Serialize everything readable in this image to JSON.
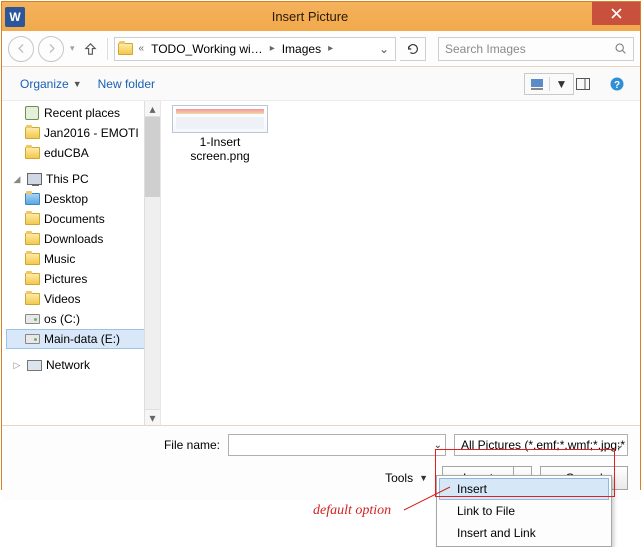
{
  "title": "Insert Picture",
  "breadcrumb": {
    "prefix": "«",
    "seg1": "TODO_Working wi…",
    "seg2": "Images"
  },
  "search": {
    "placeholder": "Search Images"
  },
  "toolbar": {
    "organize": "Organize",
    "newfolder": "New folder"
  },
  "tree": {
    "recent": "Recent places",
    "jan2016": "Jan2016 - EMOTI",
    "educba": "eduCBA",
    "thispc": "This PC",
    "desktop": "Desktop",
    "documents": "Documents",
    "downloads": "Downloads",
    "music": "Music",
    "pictures": "Pictures",
    "videos": "Videos",
    "osc": "os (C:)",
    "maindata": "Main-data (E:)",
    "network": "Network"
  },
  "file": {
    "name_line1": "1-Insert",
    "name_line2": "screen.png"
  },
  "bottom": {
    "filename_label": "File name:",
    "filename_value": "",
    "filter": "All Pictures (*.emf;*.wmf;*.jpg;*",
    "tools": "Tools",
    "insert": "Insert",
    "cancel": "Cancel"
  },
  "menu": {
    "insert": "Insert",
    "linktofile": "Link to File",
    "insertandlink": "Insert and Link"
  },
  "annotation": "default option"
}
